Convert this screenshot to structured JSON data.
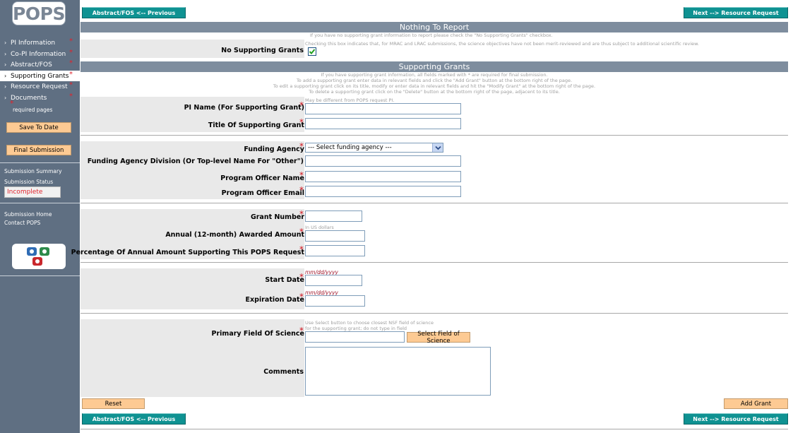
{
  "sidebar": {
    "logo_text": "POPS",
    "nav_items": [
      {
        "label": "PI Information",
        "required": "*"
      },
      {
        "label": "Co-PI Information",
        "required": "*"
      },
      {
        "label": "Abstract/FOS",
        "required": "*"
      },
      {
        "label": "Supporting Grants",
        "required": "*"
      },
      {
        "label": "Resource Request",
        "required": "*"
      },
      {
        "label": "Documents",
        "required": "*"
      }
    ],
    "required_star": "*",
    "required_legend": "required pages",
    "save_label": "Save To Date",
    "final_label": "Final Submission",
    "submission_summary": "Submission Summary",
    "submission_status_label": "Submission Status",
    "status_value": "Incomplete",
    "submission_home": "Submission Home",
    "contact": "Contact POPS"
  },
  "nav": {
    "prev_label": "Abstract/FOS <-- Previous",
    "next_label": "Next --> Resource Request"
  },
  "nothing_to_report": {
    "title": "Nothing To Report",
    "note1": "If you have no supporting grant information to report please check the \"No Supporting Grants\" checkbox.",
    "note2": "Checking this box indicates that, for MRAC and LRAC submissions, the science objectives have not been merit-reviewed and are thus subject to additional scientific review.",
    "checkbox_label": "No Supporting Grants"
  },
  "supporting_grants": {
    "title": "Supporting Grants",
    "instructions": [
      "If you have supporting grant information, all fields marked with * are required for final submission.",
      "To add a supporting grant enter data in relevant fields and click the \"Add Grant\" button at the bottom right of the page.",
      "To edit a supporting grant click on its title, modify or enter data in relevant fields and hit the \"Modify Grant\" at the bottom right of the page.",
      "To delete a supporting grant click on the \"Delete\" button at the bottom right of the page, adjacent to its title."
    ],
    "pi_hint": "May be different from POPS request PI.",
    "pi_name_label": "PI Name (For Supporting Grant)",
    "title_label": "Title Of Supporting Grant",
    "agency_label": "Funding Agency",
    "agency_selected": "--- Select funding agency ---",
    "division_label": "Funding Agency Division (Or Top-level Name For \"Other\")",
    "officer_name_label": "Program Officer Name",
    "officer_email_label": "Program Officer Email",
    "grant_number_label": "Grant Number",
    "amount_hint": "In US dollars",
    "amount_label": "Annual (12-month) Awarded Amount",
    "percentage_label": "Percentage Of Annual Amount Supporting This POPS Request",
    "date_hint": "mm/dd/yyyy",
    "start_date_label": "Start Date",
    "expiration_label": "Expiration Date",
    "fos_hint1": "Use Select button to choose closest NSF field of science",
    "fos_hint2": "for the supporting grant; do not type in field",
    "fos_label": "Primary Field Of Science",
    "fos_button": "Select Field of Science",
    "comments_label": "Comments",
    "reset_label": "Reset",
    "add_label": "Add Grant",
    "star": "*"
  }
}
